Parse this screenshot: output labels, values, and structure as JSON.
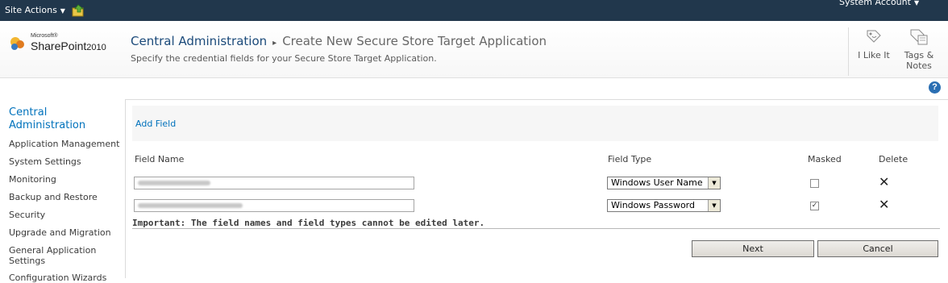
{
  "topbar": {
    "site_actions": "Site Actions",
    "account": "System Account"
  },
  "header": {
    "logo_microsoft": "Microsoft®",
    "logo_product": "SharePoint",
    "logo_year": "2010",
    "breadcrumb_root": "Central Administration",
    "breadcrumb_separator": "▸",
    "breadcrumb_current": "Create New Secure Store Target Application",
    "subtitle": "Specify the credential fields for your Secure Store Target Application.",
    "i_like_it": "I Like It",
    "tags_notes_line1": "Tags &",
    "tags_notes_line2": "Notes",
    "help": "?"
  },
  "leftnav": {
    "heading_line1": "Central",
    "heading_line2": "Administration",
    "items": [
      "Application Management",
      "System Settings",
      "Monitoring",
      "Backup and Restore",
      "Security",
      "Upgrade and Migration",
      "General Application",
      "Settings",
      "Configuration Wizards"
    ]
  },
  "form": {
    "add_field": "Add Field",
    "columns": {
      "field_name": "Field Name",
      "field_type": "Field Type",
      "masked": "Masked",
      "delete": "Delete"
    },
    "rows": [
      {
        "field_type": "Windows User Name",
        "masked": false
      },
      {
        "field_type": "Windows Password",
        "masked": true
      }
    ],
    "important_note": "Important: The field names and field types cannot be edited later.",
    "next_label": "Next",
    "cancel_label": "Cancel"
  }
}
